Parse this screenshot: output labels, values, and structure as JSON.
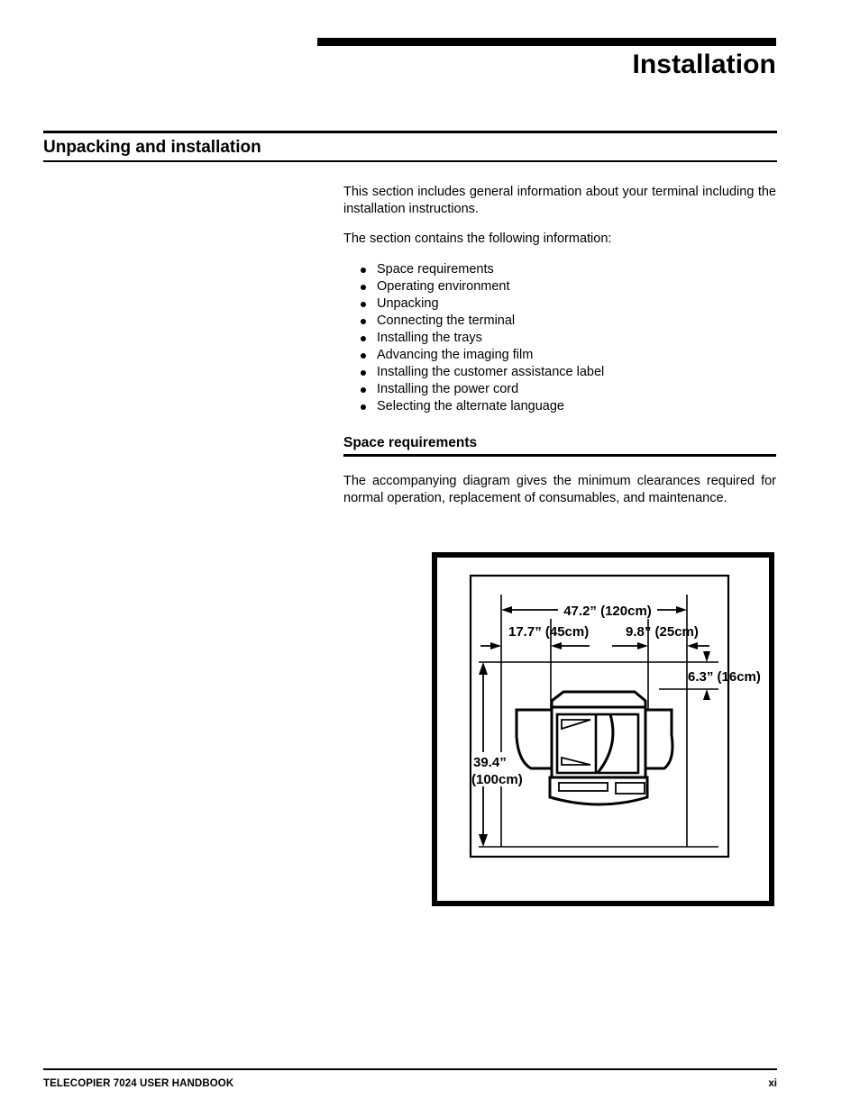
{
  "header": {
    "title": "Installation"
  },
  "section": {
    "heading": "Unpacking and installation"
  },
  "intro": {
    "paragraph_1": "This section includes general information about your terminal including the installation instructions.",
    "paragraph_2": "The section contains the following information:",
    "bullets": [
      "Space requirements",
      "Operating environment",
      "Unpacking",
      "Connecting the terminal",
      "Installing the trays",
      "Advancing the imaging film",
      "Installing the customer assistance label",
      "Installing the power cord",
      "Selecting the alternate language"
    ]
  },
  "space_requirements": {
    "heading": "Space requirements",
    "paragraph": "The accompanying diagram gives the minimum clearances required for normal operation, replacement of consumables, and maintenance."
  },
  "diagram": {
    "labels": {
      "total_width": "47.2” (120cm)",
      "left_clearance": "17.7”  (45cm)",
      "right_clearance": "9.8”  (25cm)",
      "rear_clearance": "6.3” (16cm)",
      "depth_line1": "39.4”",
      "depth_line2": "(100cm)"
    }
  },
  "footer": {
    "handbook": "TELECOPIER 7024 USER HANDBOOK",
    "page_number": "xi"
  }
}
